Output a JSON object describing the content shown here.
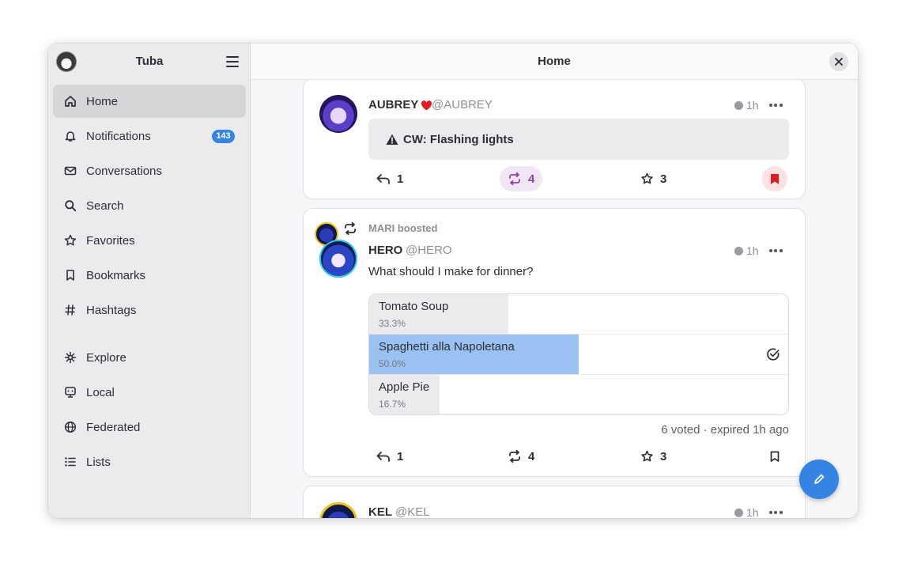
{
  "sidebar": {
    "app_title": "Tuba",
    "items": [
      {
        "label": "Home",
        "icon": "home-icon",
        "active": true
      },
      {
        "label": "Notifications",
        "icon": "bell-icon",
        "badge": "143"
      },
      {
        "label": "Conversations",
        "icon": "mail-icon"
      },
      {
        "label": "Search",
        "icon": "search-icon"
      },
      {
        "label": "Favorites",
        "icon": "star-icon"
      },
      {
        "label": "Bookmarks",
        "icon": "bookmark-icon"
      },
      {
        "label": "Hashtags",
        "icon": "hashtag-icon"
      },
      {
        "label": "Explore",
        "icon": "explore-icon"
      },
      {
        "label": "Local",
        "icon": "local-icon"
      },
      {
        "label": "Federated",
        "icon": "globe-icon"
      },
      {
        "label": "Lists",
        "icon": "list-icon"
      }
    ]
  },
  "main": {
    "title": "Home"
  },
  "posts": [
    {
      "name": "AUBREY",
      "handle": "@AUBREY",
      "time": "1h",
      "cw": "CW: Flashing lights",
      "replies": "1",
      "boosts": "4",
      "favorites": "3",
      "boosted": true,
      "bookmarked": true
    },
    {
      "boosted_by": "MARI boosted",
      "name": "HERO",
      "handle": "@HERO",
      "time": "1h",
      "text": "What should I make for dinner?",
      "poll": {
        "options": [
          {
            "title": "Tomato Soup",
            "percent_label": "33.3%",
            "fraction": 0.333,
            "chosen": false
          },
          {
            "title": "Spaghetti alla Napoletana",
            "percent_label": "50.0%",
            "fraction": 0.5,
            "chosen": true
          },
          {
            "title": "Apple Pie",
            "percent_label": "16.7%",
            "fraction": 0.167,
            "chosen": false
          }
        ],
        "summary": "6 voted · expired 1h ago"
      },
      "replies": "1",
      "boosts": "4",
      "favorites": "3",
      "boosted": false,
      "bookmarked": false
    },
    {
      "name": "KEL",
      "handle": "@KEL",
      "time": "1h"
    }
  ],
  "colors": {
    "accent": "#3584e4",
    "boost_purple": "#9141ac",
    "bookmark_red": "#e01b24",
    "poll_chosen": "#99c1f1"
  }
}
